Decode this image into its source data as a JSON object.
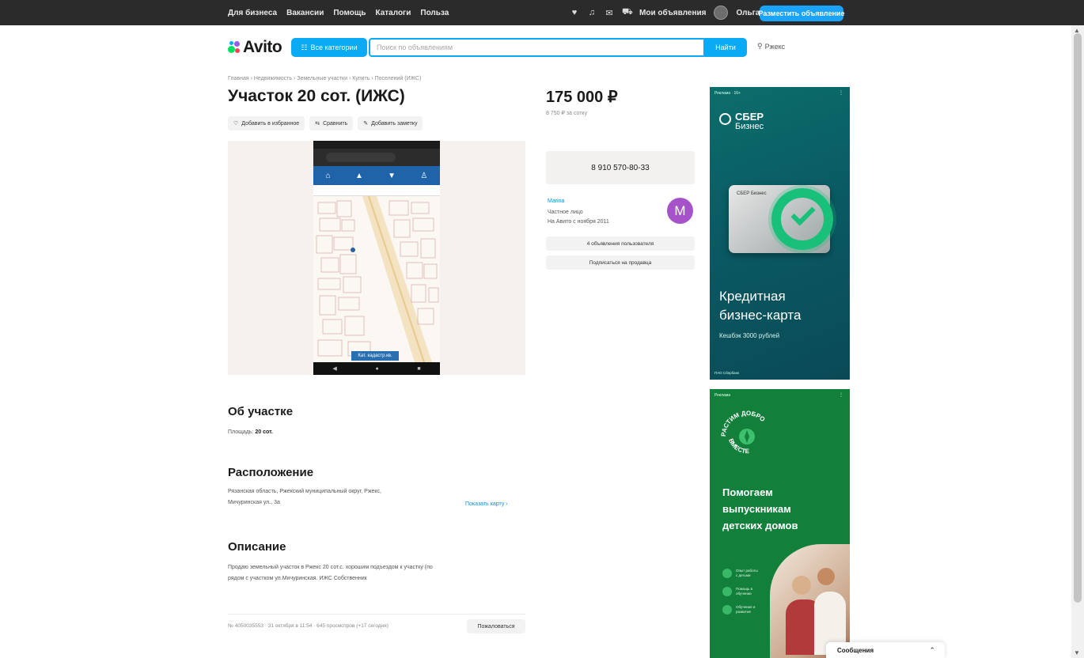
{
  "topbar": {
    "links": [
      "Для бизнеса",
      "Вакансии",
      "Помощь",
      "Каталоги",
      "Польза"
    ],
    "my_listings": "Мои объявления",
    "user": "Ольга",
    "post_button": "Разместить объявление"
  },
  "header": {
    "logo": "Avito",
    "categories_button": "Все категории",
    "search_placeholder": "Поиск по объявлениям",
    "find_button": "Найти",
    "location": "Ржекс"
  },
  "breadcrumb": "Главная › Недвижимость › Земельные участки › Купить › Поселений (ИЖС)",
  "listing": {
    "title": "Участок 20 сот. (ИЖС)",
    "actions": {
      "favorite": "Добавить в избранное",
      "compare": "Сравнить",
      "note": "Добавить заметку"
    },
    "photo_tag": "Кат. кадастр.кв."
  },
  "about": {
    "heading": "Об участке",
    "area_label": "Площадь:",
    "area_value": "20 сот."
  },
  "location_section": {
    "heading": "Расположение",
    "address_line1": "Рязанская область, Ржекский муниципальный округ, Ржекс,",
    "address_line2": "Мичуринская ул., 3а",
    "map_link": "Показать карту ›"
  },
  "description": {
    "heading": "Описание",
    "line1": "Продаю земельный участок в Ржекс 20 сот.с. хорошим подъездом к участку (по",
    "line2": "рядом с участком ул.Мичуринская. ИЖС Собственник"
  },
  "footer_meta": {
    "text": "№ 4050035553 · 31 октября в 11:54 · 645 просмотров (+17 сегодня)",
    "complain_button": "Пожаловаться"
  },
  "pricing": {
    "price": "175 000 ₽",
    "per_unit": "8 750 ₽ за сотку",
    "phone_button": "8 910 570-80-33"
  },
  "seller": {
    "name": "Marina",
    "type": "Частное лицо",
    "since": "На Авито с ноября 2011",
    "avatar_letter": "М",
    "all_listings_button": "4 объявления пользователя",
    "subscribe_button": "Подписаться на продавца"
  },
  "ad1": {
    "tag": "Реклама · 16+",
    "brand_line1": "СБЕР",
    "brand_line2": "Бизнес",
    "card_label": "СБЕР Бизнес",
    "headline_line1": "Кредитная",
    "headline_line2": "бизнес-карта",
    "subline": "Кешбэк 3000 рублей",
    "footer": "ПАО Сбербанк"
  },
  "ad2": {
    "tag": "Реклама",
    "seal_top": "РАСТИМ ДОБРО",
    "seal_bottom": "ВМЕСТЕ",
    "headline_line1": "Помогаем",
    "headline_line2": "выпускникам",
    "headline_line3": "детских домов",
    "features": [
      "Опыт работы с детьми",
      "Помощь в обучении",
      "Обучение и развитие"
    ]
  },
  "messages_panel": {
    "label": "Сообщения"
  },
  "colors": {
    "accent": "#0aaaf5",
    "topbar": "#2b2b2b",
    "seller_avatar": "#a652c9",
    "ad1_bg": "#0b6e6b",
    "ad2_bg": "#12803a"
  }
}
